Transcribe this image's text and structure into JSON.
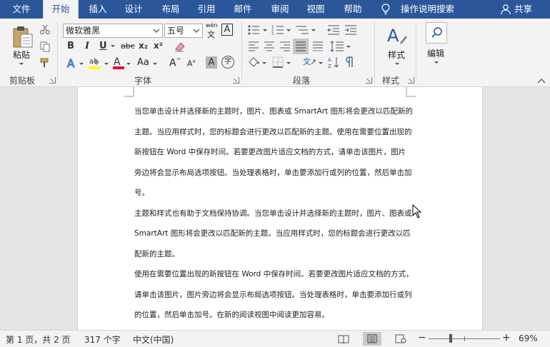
{
  "tabs": [
    {
      "label": "文件",
      "active": false
    },
    {
      "label": "开始",
      "active": true
    },
    {
      "label": "插入",
      "active": false
    },
    {
      "label": "设计",
      "active": false
    },
    {
      "label": "布局",
      "active": false
    },
    {
      "label": "引用",
      "active": false
    },
    {
      "label": "邮件",
      "active": false
    },
    {
      "label": "审阅",
      "active": false
    },
    {
      "label": "视图",
      "active": false
    },
    {
      "label": "帮助",
      "active": false
    }
  ],
  "tell_me": "操作说明搜索",
  "share": "共享",
  "ribbon": {
    "clipboard": {
      "paste_label": "粘贴",
      "group_label": "剪贴板"
    },
    "font": {
      "font_name": "微软雅黑",
      "font_size": "五号",
      "wen_label": "wén",
      "group_label": "字体",
      "bold": "B",
      "italic": "I",
      "underline": "U",
      "strike": "abc",
      "subscript": "x₂",
      "superscript": "x²",
      "grow": "A",
      "shrink": "A",
      "case": "Aa",
      "char_shade": "A",
      "enclose": "字"
    },
    "paragraph": {
      "group_label": "段落"
    },
    "styles": {
      "label": "样式",
      "group_label": "样式"
    },
    "editing": {
      "label": "编辑"
    }
  },
  "document": {
    "lines": [
      "当您单击设计并选择新的主题时，图片、图表或  SmartArt  图形将会更改以匹配新的",
      "主题。当应用样式时，您的标题会进行更改以匹配新的主题。使用在需要位置出现的",
      "新按钮在  Word  中保存时间。若要更改图片适应文档的方式，请单击该图片，图片",
      "旁边将会显示布局选项按钮。当处理表格时，单击要添加行或列的位置，然后单击加",
      "号。",
      "主题和样式也有助于文档保持协调。当您单击设计并选择新的主题时，图片、图表或",
      "SmartArt  图形将会更改以匹配新的主题。当应用样式时，您的标题会进行更改以匹",
      "配新的主题。",
      "使用在需要位置出现的新按钮在  Word  中保存时间。若要更改图片适应文档的方式，",
      "请单击该图片，图片旁边将会显示布局选项按钮。当处理表格时，单击要添加行或列",
      "的位置，然后单击加号。在新的阅读视图中阅读更加容易。"
    ]
  },
  "status": {
    "page": "第 1 页，共 2 页",
    "words": "317 个字",
    "language": "中文(中国)",
    "zoom_minus": "−",
    "zoom_plus": "+",
    "zoom_percent": "69%"
  },
  "colors": {
    "accent": "#2b579a",
    "font_red": "#e81123",
    "highlight_yellow": "#ffff00"
  }
}
